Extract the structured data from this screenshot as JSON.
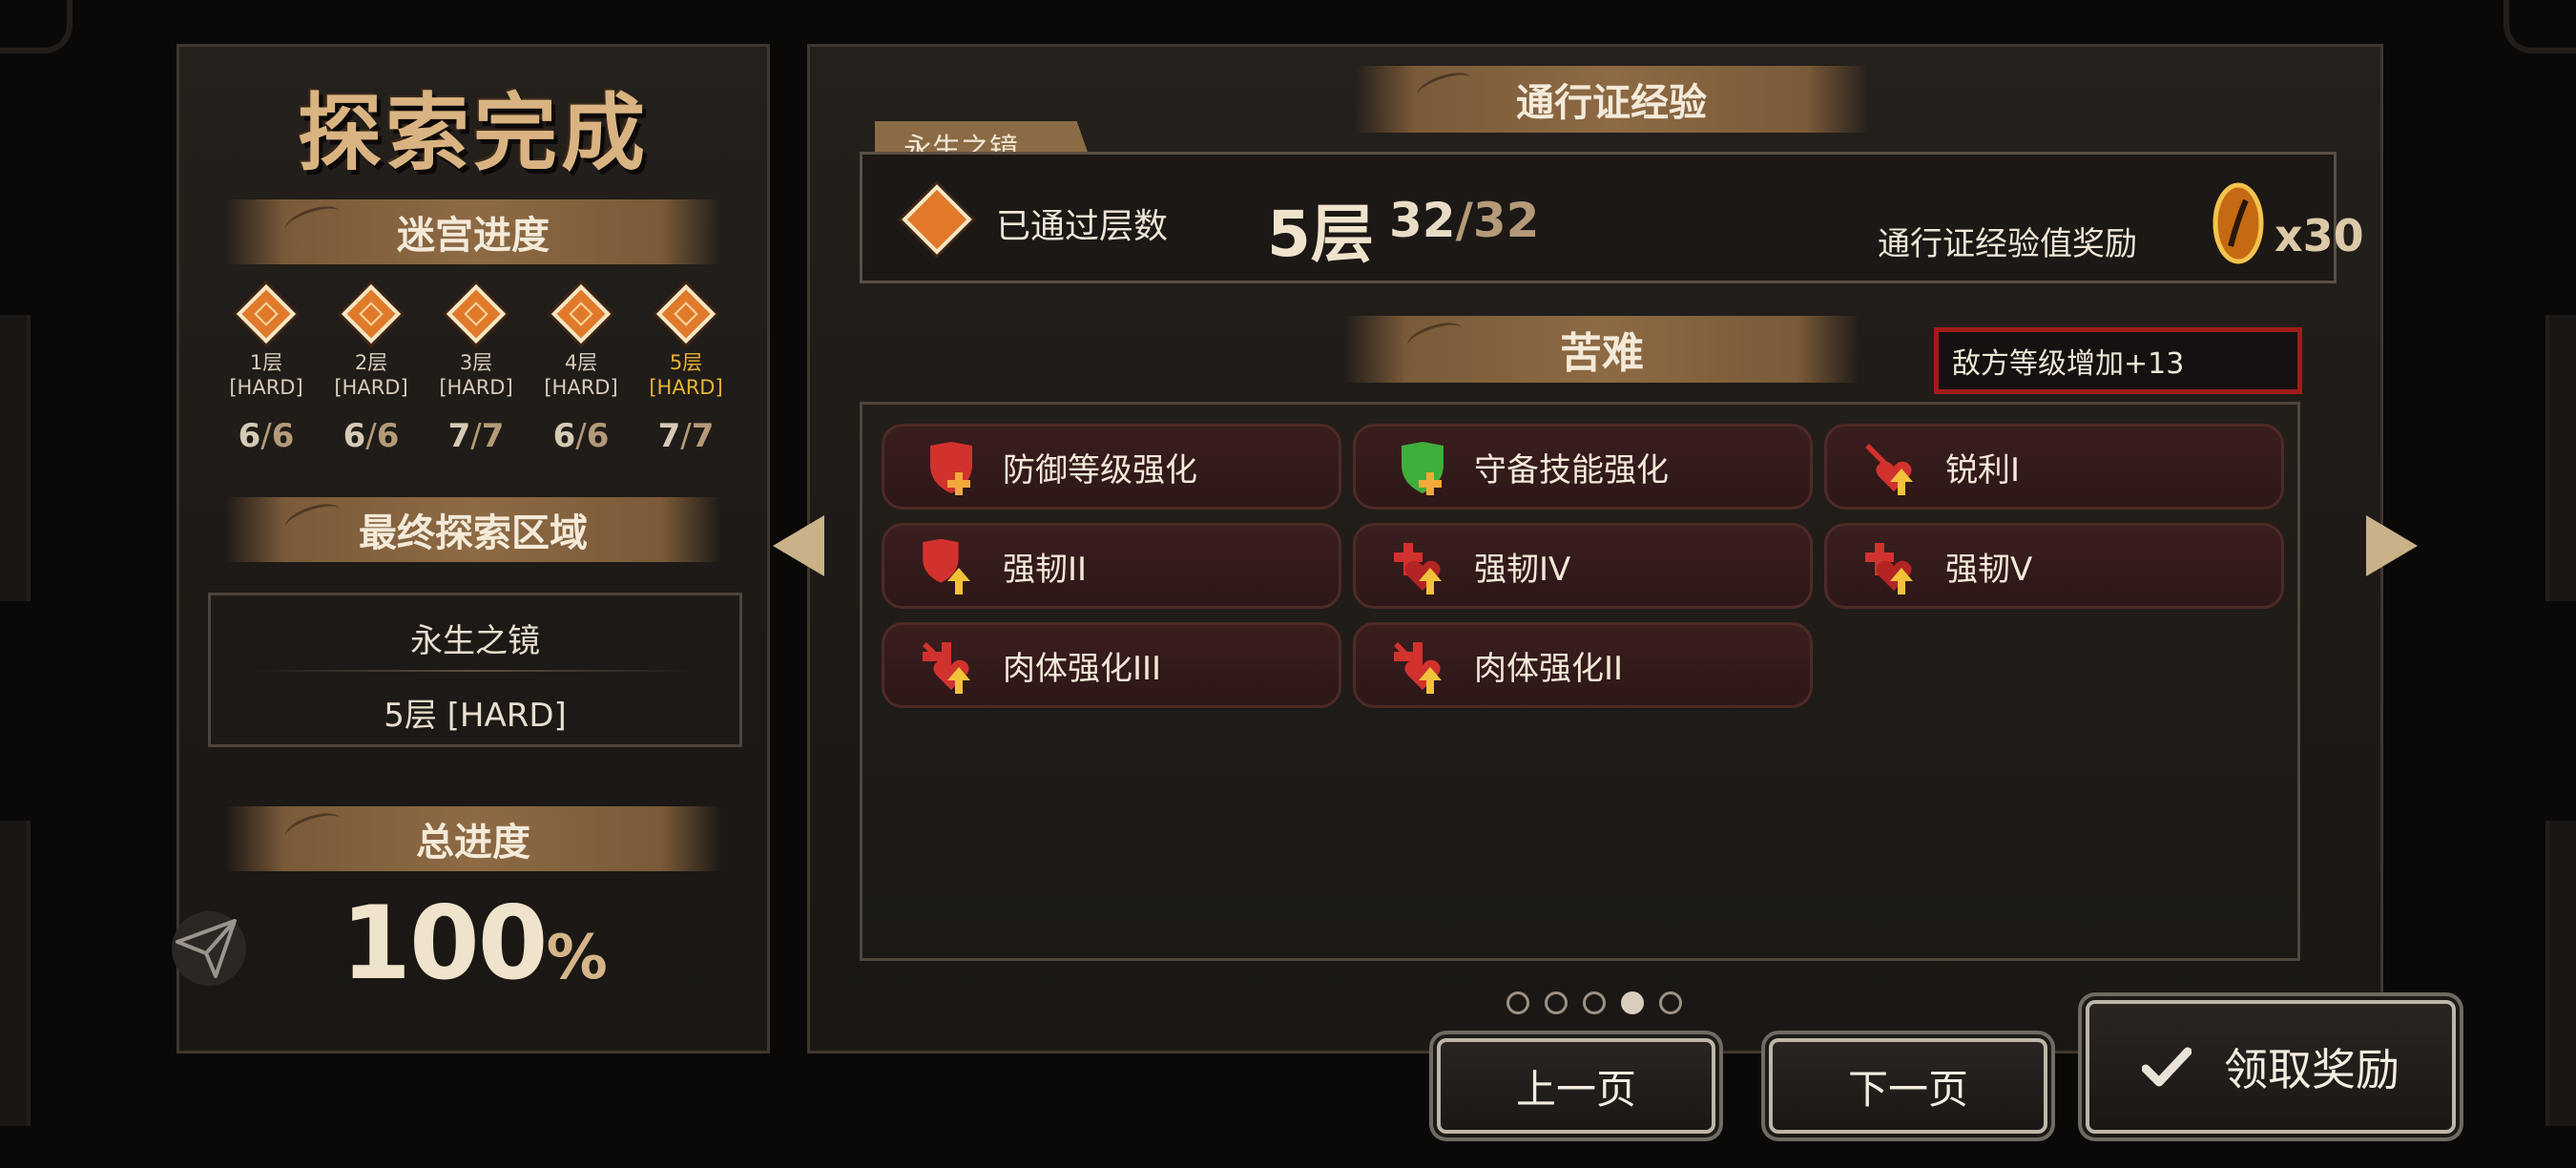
{
  "left": {
    "title": "探索完成",
    "maze_progress_label": "迷宫进度",
    "floors": [
      {
        "name": "1层",
        "difficulty": "[HARD]",
        "cleared": "6",
        "total": "6",
        "highlight": false
      },
      {
        "name": "2层",
        "difficulty": "[HARD]",
        "cleared": "6",
        "total": "6",
        "highlight": false
      },
      {
        "name": "3层",
        "difficulty": "[HARD]",
        "cleared": "7",
        "total": "7",
        "highlight": false
      },
      {
        "name": "4层",
        "difficulty": "[HARD]",
        "cleared": "6",
        "total": "6",
        "highlight": false
      },
      {
        "name": "5层",
        "difficulty": "[HARD]",
        "cleared": "7",
        "total": "7",
        "highlight": true
      }
    ],
    "final_area_label": "最终探索区域",
    "final_area_name": "永生之镜",
    "final_area_floor": "5层 [HARD]",
    "total_progress_label": "总进度",
    "total_progress_value": "100",
    "total_progress_unit": "%"
  },
  "right": {
    "pass_exp_label": "通行证经验",
    "dungeon_tab": "永生之镜",
    "passed_floors_label": "已通过层数",
    "passed_floor_value": "5层",
    "passed_count": "32",
    "passed_total": "32",
    "pass_reward_label": "通行证经验值奖励",
    "pass_reward_amount": "x30",
    "hardship_label": "苦难",
    "enemy_level_text": "敌方等级增加+13",
    "buffs": [
      {
        "label": "防御等级强化",
        "icon": "shield-plus-icon",
        "color": "#d2322e"
      },
      {
        "label": "守备技能强化",
        "icon": "shield-plus-icon",
        "color": "#3fae3a"
      },
      {
        "label": "锐利I",
        "icon": "sword-heart-icon",
        "color": "#d2322e"
      },
      {
        "label": "强韧II",
        "icon": "shield-up-icon",
        "color": "#d2322e"
      },
      {
        "label": "强韧IV",
        "icon": "cross-up-icon",
        "color": "#d2322e"
      },
      {
        "label": "强韧V",
        "icon": "cross-up-icon",
        "color": "#d2322e"
      },
      {
        "label": "肉体强化III",
        "icon": "body-up-icon",
        "color": "#d2322e"
      },
      {
        "label": "肉体强化II",
        "icon": "body-up-icon",
        "color": "#d2322e"
      }
    ],
    "page_count": 5,
    "current_page": 4
  },
  "buttons": {
    "prev_page": "上一页",
    "next_page": "下一页",
    "claim": "领取奖励",
    "claim_icon": "checkmark-icon"
  }
}
